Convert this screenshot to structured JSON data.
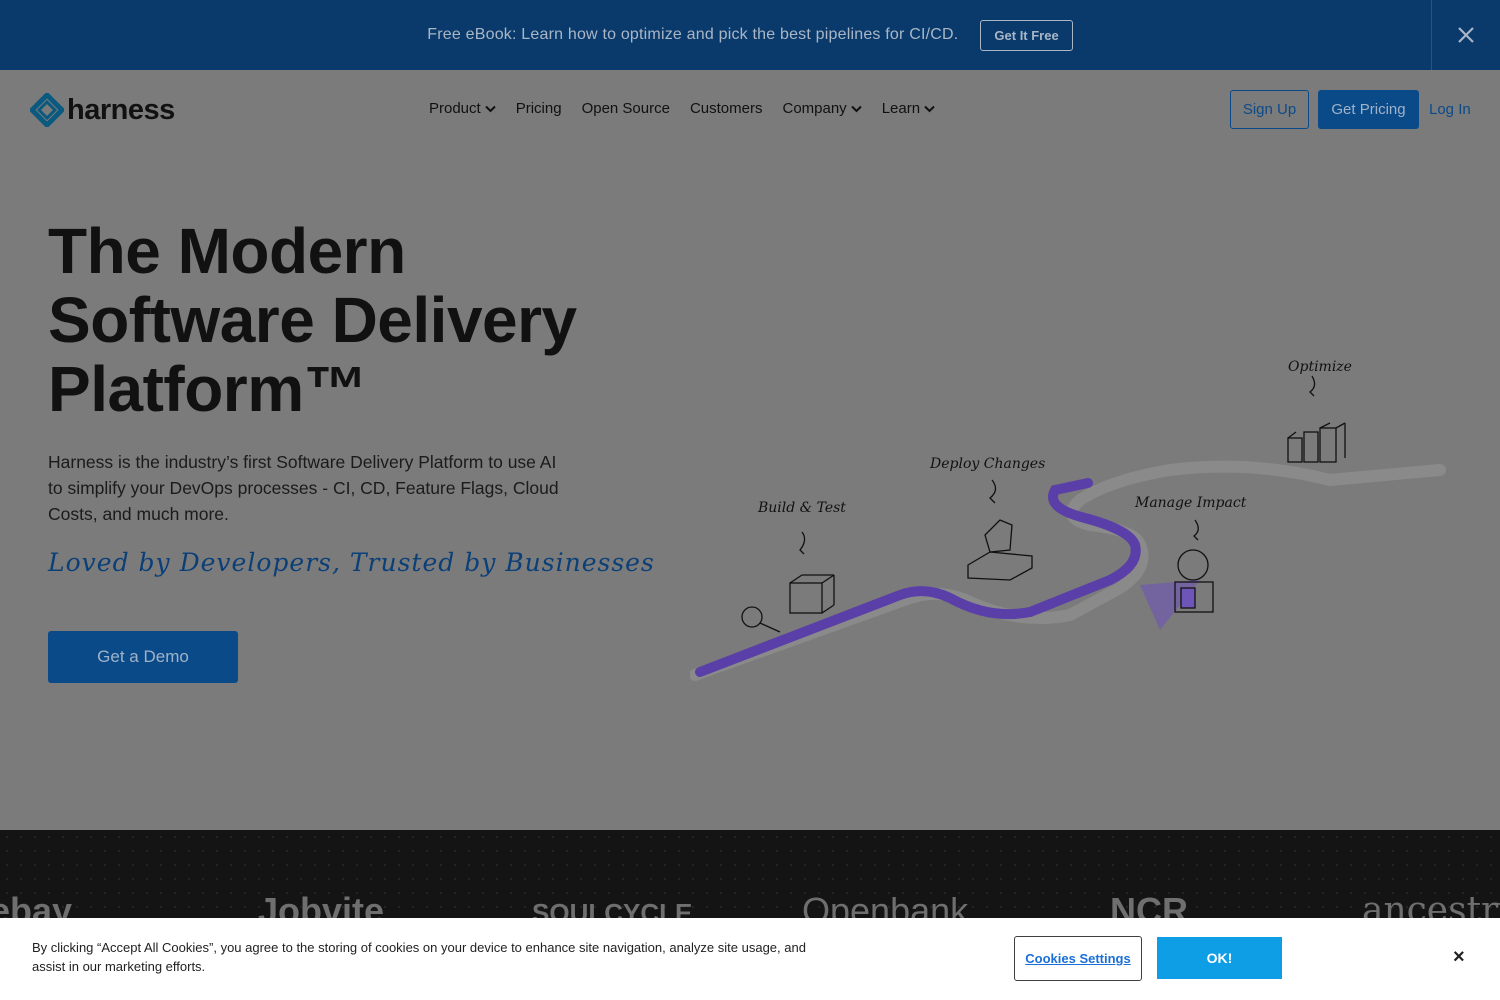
{
  "promo": {
    "text": "Free eBook: Learn how to optimize and pick the best pipelines for CI/CD.",
    "button": "Get It Free",
    "close_icon": "close-icon"
  },
  "nav": {
    "logo_text": "harness",
    "items": [
      {
        "label": "Product",
        "dropdown": true
      },
      {
        "label": "Pricing",
        "dropdown": false
      },
      {
        "label": "Open Source",
        "dropdown": false
      },
      {
        "label": "Customers",
        "dropdown": false
      },
      {
        "label": "Company",
        "dropdown": true
      },
      {
        "label": "Learn",
        "dropdown": true
      }
    ],
    "signup": "Sign Up",
    "get_pricing": "Get Pricing",
    "login": "Log In"
  },
  "hero": {
    "title_line1": "The Modern",
    "title_line2": "Software Delivery",
    "title_line3": "Platform™",
    "subtitle": "Harness is the industry’s first Software Delivery Platform to use AI to simplify your DevOps processes - CI, CD, Feature Flags, Cloud Costs, and much more.",
    "tagline": "Loved by Developers, Trusted by Businesses",
    "cta": "Get a Demo"
  },
  "illustration": {
    "labels": [
      "Build & Test",
      "Deploy Changes",
      "Manage Impact",
      "Optimize"
    ],
    "colors": {
      "path": "#5b3fa8",
      "shadow": "#8a8a8a"
    }
  },
  "customer_logos": [
    "ebay",
    "Jobvite",
    "SOULCYCLE",
    "Openbank",
    "NCR",
    "ancestry"
  ],
  "cookie": {
    "text": "By clicking “Accept All Cookies”, you agree to the storing of cookies on your device to enhance site navigation, analyze site usage, and assist in our marketing efforts.",
    "settings": "Cookies Settings",
    "ok": "OK!",
    "close": "×"
  },
  "colors": {
    "brand_blue": "#0b4a88",
    "banner_bg": "#0a3a6b",
    "ok_button": "#0d9ee6",
    "overlay_bg": "#7b7b7b"
  }
}
